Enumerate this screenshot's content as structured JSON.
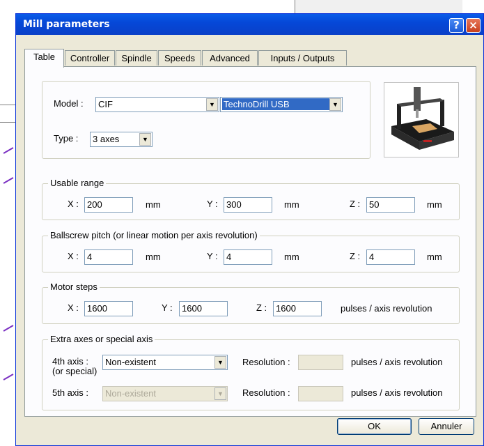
{
  "window": {
    "title": "Mill parameters",
    "help_glyph": "?",
    "close_glyph": "×"
  },
  "tabs": [
    {
      "label": "Table",
      "active": true
    },
    {
      "label": "Controller",
      "active": false
    },
    {
      "label": "Spindle",
      "active": false
    },
    {
      "label": "Speeds",
      "active": false
    },
    {
      "label": "Advanced",
      "active": false
    },
    {
      "label": "Inputs / Outputs",
      "active": false
    }
  ],
  "model": {
    "label": "Model :",
    "brand_value": "CIF",
    "machine_value": "TechnoDrill USB",
    "type_label": "Type :",
    "type_value": "3 axes",
    "image_icon": "mill-machine-photo"
  },
  "usable_range": {
    "title": "Usable range",
    "x_label": "X :",
    "x_value": "200",
    "x_unit": "mm",
    "y_label": "Y :",
    "y_value": "300",
    "y_unit": "mm",
    "z_label": "Z :",
    "z_value": "50",
    "z_unit": "mm"
  },
  "ballscrew": {
    "title": "Ballscrew pitch (or linear motion per axis revolution)",
    "x_label": "X :",
    "x_value": "4",
    "x_unit": "mm",
    "y_label": "Y :",
    "y_value": "4",
    "y_unit": "mm",
    "z_label": "Z :",
    "z_value": "4",
    "z_unit": "mm"
  },
  "motor_steps": {
    "title": "Motor steps",
    "x_label": "X :",
    "x_value": "1600",
    "y_label": "Y :",
    "y_value": "1600",
    "z_label": "Z :",
    "z_value": "1600",
    "unit": "pulses / axis revolution"
  },
  "extra_axes": {
    "title": "Extra axes or special axis",
    "axis4_label": "4th axis :",
    "axis4_sublabel": "(or special)",
    "axis4_value": "Non-existent",
    "axis4_resolution_label": "Resolution :",
    "axis4_resolution_value": "",
    "axis4_unit": "pulses / axis revolution",
    "axis5_label": "5th axis :",
    "axis5_value": "Non-existent",
    "axis5_resolution_label": "Resolution :",
    "axis5_resolution_value": "",
    "axis5_unit": "pulses / axis revolution"
  },
  "buttons": {
    "ok": "OK",
    "cancel": "Annuler"
  },
  "colors": {
    "titlebar": "#0548d8",
    "dialog_bg": "#ece9d8",
    "panel_bg": "#fcfcfe",
    "selection": "#316ac5"
  }
}
